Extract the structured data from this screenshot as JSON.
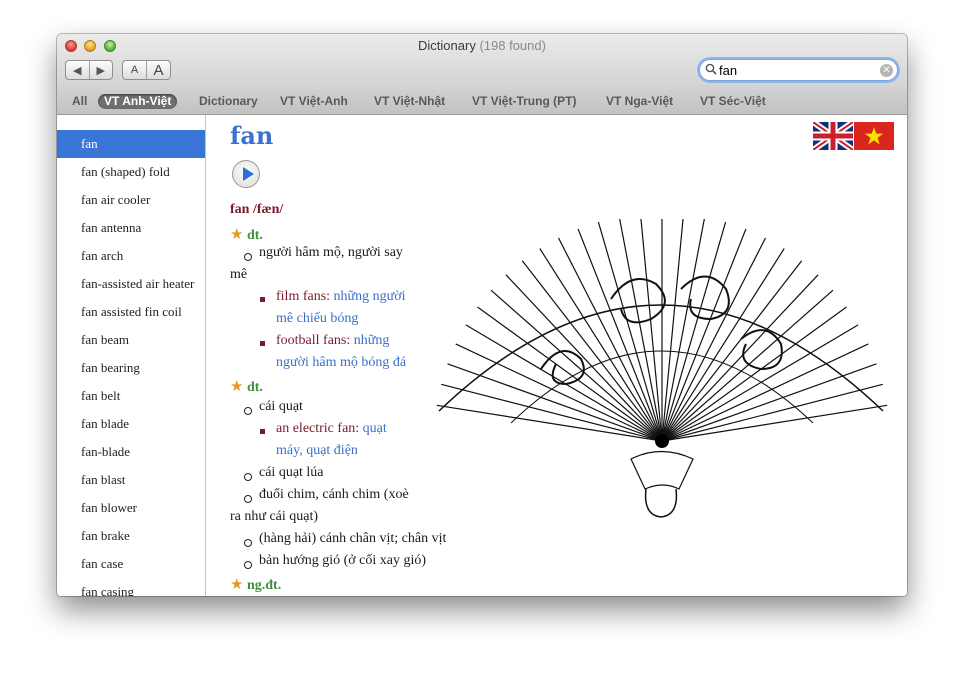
{
  "window": {
    "title": "Dictionary",
    "count": "(198 found)"
  },
  "toolbar": {
    "back": "◀",
    "forward": "▶",
    "font_small": "A",
    "font_large": "A"
  },
  "search": {
    "value": "fan",
    "placeholder": "Search"
  },
  "tabs": [
    {
      "label": "All",
      "active": false
    },
    {
      "label": "VT Anh-Việt",
      "active": true
    },
    {
      "label": "Dictionary",
      "active": false
    },
    {
      "label": "VT Việt-Anh",
      "active": false
    },
    {
      "label": "VT Việt-Nhật",
      "active": false
    },
    {
      "label": "VT Việt-Trung (PT)",
      "active": false
    },
    {
      "label": "VT Nga-Việt",
      "active": false
    },
    {
      "label": "VT Séc-Việt",
      "active": false
    }
  ],
  "sidebar": {
    "items": [
      "fan",
      "fan (shaped) fold",
      "fan air cooler",
      "fan antenna",
      "fan arch",
      "fan-assisted air heater",
      "fan assisted fin coil",
      "fan beam",
      "fan bearing",
      "fan belt",
      "fan blade",
      "fan-blade",
      "fan blast",
      "fan blower",
      "fan brake",
      "fan case",
      "fan casing"
    ]
  },
  "entry": {
    "headword": "fan",
    "pronunciation": "fan /fæn/",
    "pos1": "dt.",
    "sense1_a": "người hâm mộ, người say",
    "sense1_b": "mê",
    "ex1_en": "film fans:",
    "ex1_vi_a": "những người",
    "ex1_vi_b": "mê chiếu bóng",
    "ex2_en": "football fans:",
    "ex2_vi_a": "những",
    "ex2_vi_b": "người hâm mộ bóng đá",
    "pos2": "dt.",
    "sense2": "cái quạt",
    "ex3_en": "an electric fan:",
    "ex3_vi_a": "quạt",
    "ex3_vi_b": "máy, quạt điện",
    "sense3": "cái quạt lúa",
    "sense4_a": "đuổi chim, cánh chim (xoè",
    "sense4_b": "ra như cái quạt)",
    "sense5": "(hàng hải) cánh chân vịt; chân vịt",
    "sense6": "bản hướng gió (ở cối xay gió)",
    "pos3": "ng.đt."
  },
  "colors": {
    "selection": "#3875d7",
    "headword": "#3c6fd0",
    "example": "#7b1a2b",
    "translation": "#3b6fc7",
    "pos": "#3f8f3d"
  }
}
